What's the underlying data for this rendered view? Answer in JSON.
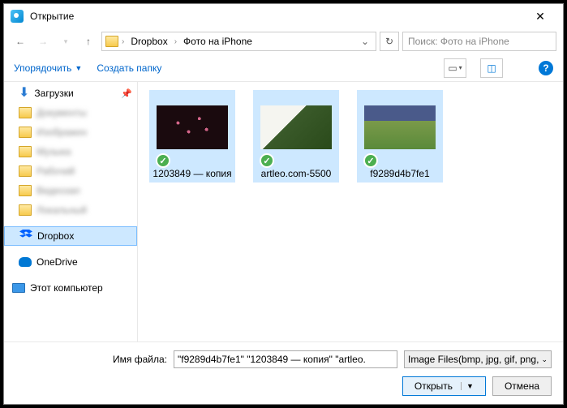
{
  "title": "Открытие",
  "breadcrumb": {
    "root": "Dropbox",
    "current": "Фото на iPhone"
  },
  "search_placeholder": "Поиск: Фото на iPhone",
  "toolbar": {
    "organize": "Упорядочить",
    "newfolder": "Создать папку"
  },
  "sidebar": {
    "downloads": "Загрузки",
    "blur1": "Документы",
    "blur2": "Изображен",
    "blur3": "Музыка",
    "blur4": "Рабочий",
    "blur5": "Видеозап",
    "blur6": "Локальный",
    "dropbox": "Dropbox",
    "onedrive": "OneDrive",
    "computer": "Этот компьютер"
  },
  "files": [
    {
      "name": "1203849 — копия"
    },
    {
      "name": "artleo.com-5500"
    },
    {
      "name": "f9289d4b7fe1"
    }
  ],
  "filename_label": "Имя файла:",
  "filename_value": "\"f9289d4b7fe1\" \"1203849 — копия\" \"artleo.",
  "filter": "Image Files(bmp, jpg, gif, png,",
  "open_btn": "Открыть",
  "cancel_btn": "Отмена"
}
